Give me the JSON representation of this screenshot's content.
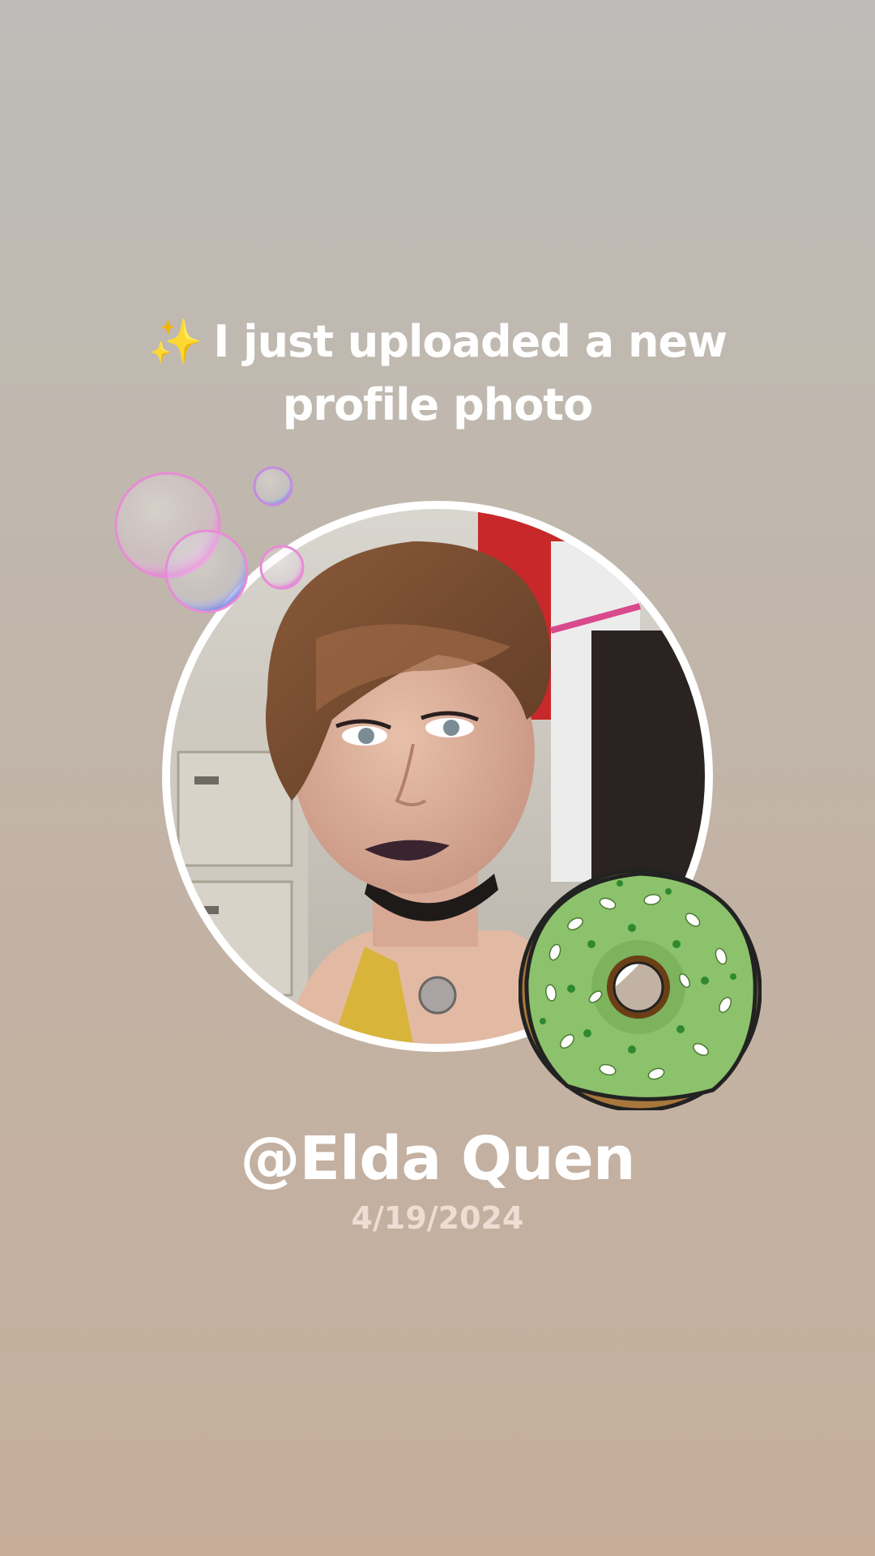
{
  "post": {
    "sparkle_icon": "✨",
    "headline_line1": "I just uploaded a new",
    "headline_line2": "profile photo",
    "username": "@Elda Quen",
    "date": "4/19/2024"
  },
  "decorations": {
    "bubbles": "soap-bubbles-sticker",
    "donut": "green-frosted-donut-sticker"
  },
  "colors": {
    "background_top": "#bdbcb8",
    "background_bottom": "#c6ae9b",
    "text": "#ffffff",
    "date_text": "#eeddd3",
    "avatar_ring": "#ffffff",
    "donut_frosting": "#8cc26b"
  }
}
